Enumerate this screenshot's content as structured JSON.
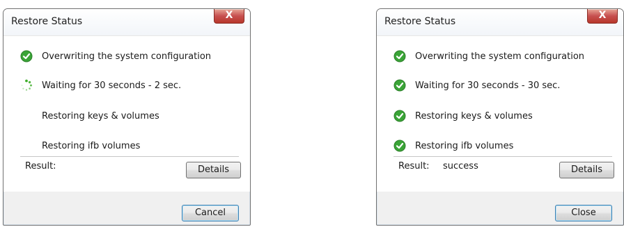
{
  "dialogs": [
    {
      "title": "Restore Status",
      "close_glyph": "X",
      "steps": [
        {
          "label": "Overwriting the system configuration",
          "status": "done"
        },
        {
          "label": "Waiting for 30 seconds - 2 sec.",
          "status": "in-progress"
        },
        {
          "label": "Restoring keys & volumes",
          "status": "pending"
        },
        {
          "label": "Restoring ifb volumes",
          "status": "pending"
        }
      ],
      "result_label": "Result:",
      "result_value": "",
      "details_label": "Details",
      "footer_button_label": "Cancel"
    },
    {
      "title": "Restore Status",
      "close_glyph": "X",
      "steps": [
        {
          "label": "Overwriting the system configuration",
          "status": "done"
        },
        {
          "label": "Waiting for 30 seconds - 30 sec.",
          "status": "done"
        },
        {
          "label": "Restoring keys & volumes",
          "status": "done"
        },
        {
          "label": "Restoring ifb volumes",
          "status": "done"
        }
      ],
      "result_label": "Result:",
      "result_value": "success",
      "details_label": "Details",
      "footer_button_label": "Close"
    }
  ],
  "colors": {
    "check_green": "#3aa437",
    "spinner_green": "#3fae2a",
    "close_red": "#c75050"
  },
  "icons": {
    "done": "check-circle-icon",
    "in-progress": "spinner-icon",
    "close": "close-icon"
  }
}
